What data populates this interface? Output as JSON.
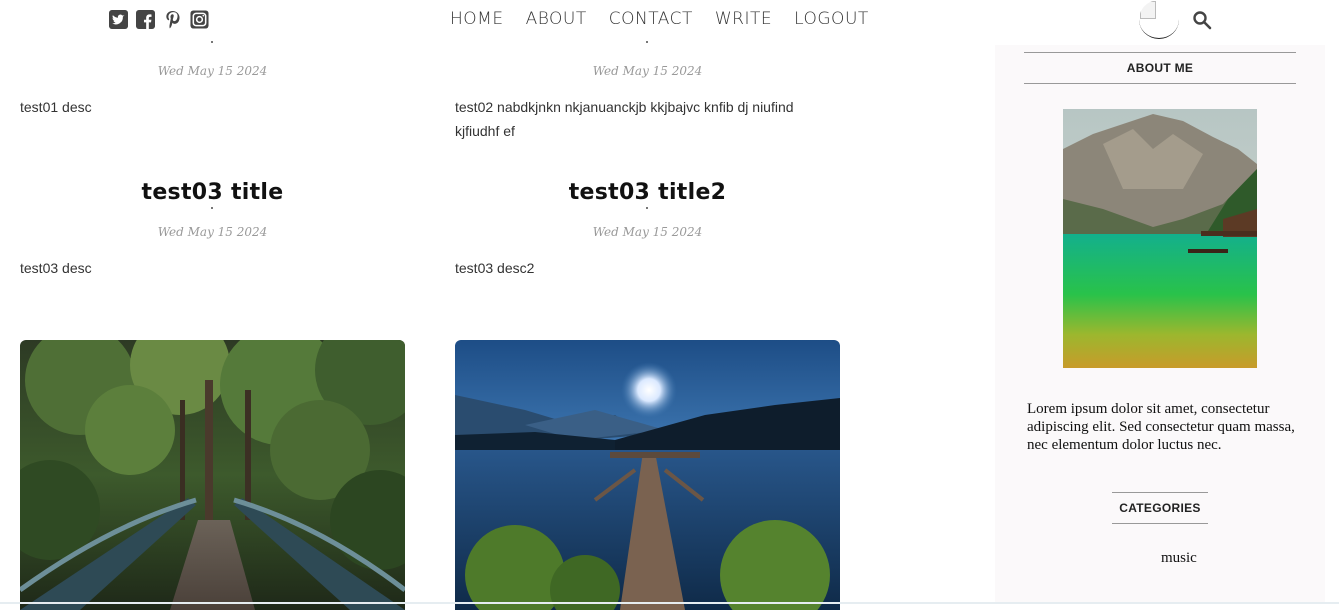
{
  "header": {
    "social_icons": [
      "twitter-icon",
      "facebook-icon",
      "pinterest-icon",
      "instagram-icon"
    ],
    "nav": [
      "HOME",
      "ABOUT",
      "CONTACT",
      "WRITE",
      "LOGOUT"
    ],
    "search_icon": "search-icon"
  },
  "posts": [
    {
      "date": "Wed May 15 2024",
      "desc": "test01 desc"
    },
    {
      "date": "Wed May 15 2024",
      "desc_line1": "test02 nabdkjnkn nkjanuanckjb kkjbajvc knfib dj niufind",
      "desc_line2": "kjfiudhf ef"
    },
    {
      "title": "test03 title",
      "date": "Wed May 15 2024",
      "desc": "test03 desc"
    },
    {
      "title": "test03 title2",
      "date": "Wed May 15 2024",
      "desc": "test03 desc2"
    }
  ],
  "sidebar": {
    "about_heading": "ABOUT ME",
    "about_text": "Lorem ipsum dolor sit amet, consectetur adipiscing elit. Sed consectetur quam massa, nec elementum dolor luctus nec.",
    "categories_heading": "CATEGORIES",
    "categories": [
      "music"
    ]
  },
  "colors": {
    "nav_text": "#333333",
    "date_text": "#999999",
    "sidebar_bg": "#fbf9fa"
  }
}
